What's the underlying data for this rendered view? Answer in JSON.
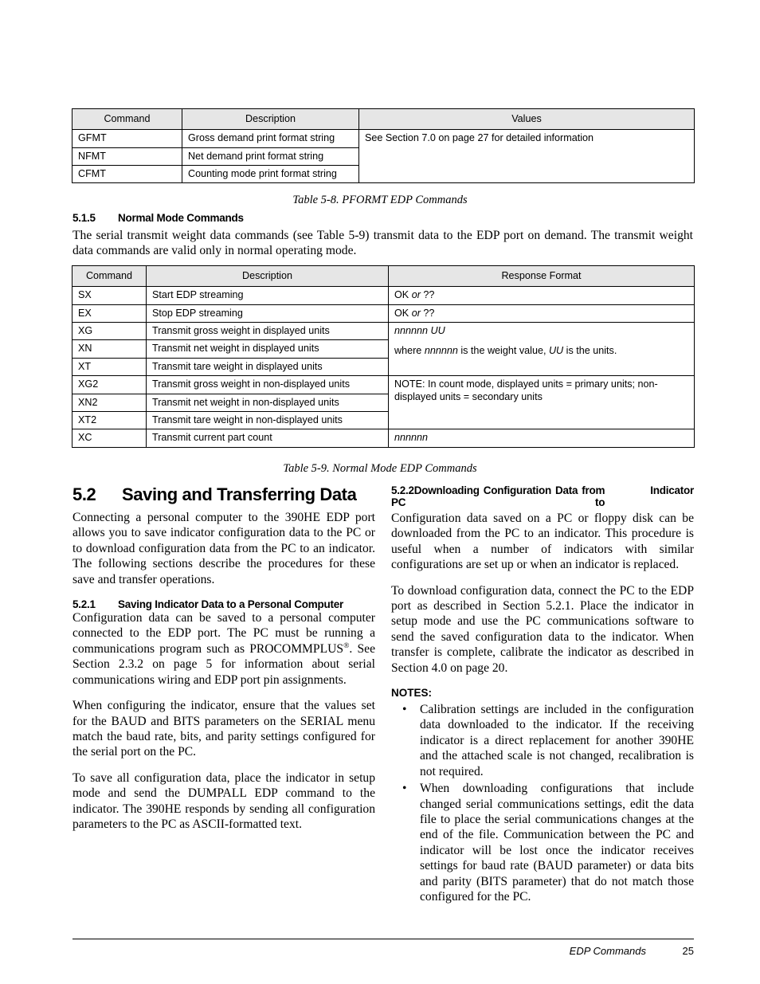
{
  "tables": [
    {
      "id": "table-5-8",
      "caption": "Table 5-8. PFORMT EDP Commands",
      "headers": [
        "Command",
        "Description",
        "Values"
      ],
      "rows": [
        [
          "GFMT",
          "Gross demand print format string",
          "See Section 7.0 on page 27 for detailed information"
        ],
        [
          "NFMT",
          "Net demand print format string",
          ""
        ],
        [
          "CFMT",
          "Counting mode print format string",
          ""
        ]
      ]
    },
    {
      "id": "table-5-9",
      "caption": "Table 5-9. Normal Mode EDP Commands",
      "headers": [
        "Command",
        "Description",
        "Response Format"
      ],
      "rows": [
        [
          "SX",
          "Start EDP streaming",
          "OK or ??"
        ],
        [
          "EX",
          "Stop EDP streaming",
          "OK or ??"
        ],
        [
          "XG",
          "Transmit gross weight in displayed units",
          "nnnnnn UU"
        ],
        [
          "XN",
          "Transmit net weight in displayed units",
          "where nnnnnn is the weight value, UU is the units."
        ],
        [
          "XT",
          "Transmit tare weight in displayed units",
          ""
        ],
        [
          "XG2",
          "Transmit gross weight in non-displayed units",
          "NOTE: In count mode, displayed units = primary units; non-displayed units = secondary units"
        ],
        [
          "XN2",
          "Transmit net weight in non-displayed units",
          ""
        ],
        [
          "XT2",
          "Transmit tare weight in non-displayed units",
          ""
        ],
        [
          "XC",
          "Transmit current part count",
          "nnnnnn"
        ]
      ]
    }
  ],
  "section_515": {
    "number": "5.1.5",
    "title": "Normal Mode Commands",
    "body": "The serial transmit weight data commands (see Table 5-9) transmit data to the EDP port on demand. The transmit weight data commands are valid only in normal operating mode."
  },
  "section_52": {
    "number": "5.2",
    "title": "Saving and Transferring Data",
    "body": "Connecting a personal computer to the 390HE EDP port allows you to save indicator configuration data to the PC or to download configuration data from the PC to an indicator. The following sections describe the procedures for these save and transfer operations."
  },
  "section_521": {
    "number": "5.2.1",
    "title": "Saving Indicator Data to a Personal Computer",
    "para1_a": "Configuration data can be saved to a personal computer connected to the EDP port. The PC must be running a communications program such as PROCOMMPLUS",
    "para1_reg": "®",
    "para1_b": ". See Section 2.3.2 on page 5 for information about serial communications wiring and EDP port pin assignments.",
    "para2": "When configuring the indicator, ensure that the values set for the BAUD and BITS parameters on the SERIAL menu match the baud rate, bits, and parity settings configured for the serial port on the PC.",
    "para3": "To save all configuration data, place the indicator in setup mode and send the DUMPALL EDP command to the indicator. The 390HE responds by sending all configuration parameters to the PC as ASCII-formatted text."
  },
  "section_522": {
    "number": "5.2.2",
    "title_line1": "Downloading Configuration Data from PC to",
    "title_line2": "Indicator",
    "para1": "Configuration data saved on a PC or floppy disk can be downloaded from the PC to an indicator. This procedure is useful when a number of indicators with similar configurations are set up or when an indicator is replaced.",
    "para2": "To download configuration data, connect the PC to the EDP port as described in Section 5.2.1. Place the indicator in setup mode and use the PC communications software to send the saved configuration data to the indicator. When transfer is complete, calibrate the indicator as described in Section 4.0 on page 20.",
    "notes_label": "NOTES:",
    "bullet_char": "•",
    "notes": [
      "Calibration settings are included in the configuration data downloaded to the indicator. If the receiving indicator is a direct replacement for another 390HE and the attached scale is not changed, recalibration is not required.",
      "When downloading configurations that include changed serial communications settings, edit the data file to place the serial communications changes at the end of the file. Communication between the PC and indicator will be lost once the indicator receives settings for baud rate (BAUD parameter) or data bits and parity (BITS parameter) that do not match those configured for the PC."
    ]
  },
  "footer": {
    "title": "EDP Commands",
    "page": "25"
  }
}
